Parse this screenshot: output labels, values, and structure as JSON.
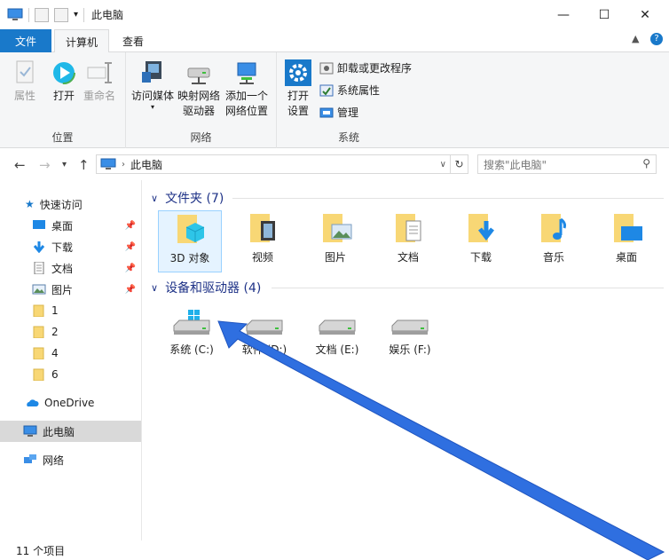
{
  "window": {
    "title": "此电脑",
    "minimize": "—",
    "maximize": "☐",
    "close": "✕"
  },
  "ribbon_tabs": {
    "file": "文件",
    "computer": "计算机",
    "view": "查看",
    "collapse": "▲",
    "help": "?"
  },
  "ribbon": {
    "location": {
      "label": "位置",
      "properties": "属性",
      "open": "打开",
      "rename": "重命名"
    },
    "network": {
      "label": "网络",
      "access_media": "访问媒体",
      "map_drive_1": "映射网络",
      "map_drive_2": "驱动器",
      "add_location_1": "添加一个",
      "add_location_2": "网络位置"
    },
    "system": {
      "label": "系统",
      "open_settings_1": "打开",
      "open_settings_2": "设置",
      "uninstall": "卸载或更改程序",
      "system_properties": "系统属性",
      "manage": "管理"
    }
  },
  "navigation": {
    "address": "此电脑",
    "search_placeholder": "搜索\"此电脑\""
  },
  "sidebar": {
    "items": [
      {
        "label": "快速访问"
      },
      {
        "label": "桌面"
      },
      {
        "label": "下载"
      },
      {
        "label": "文档"
      },
      {
        "label": "图片"
      },
      {
        "label": "1"
      },
      {
        "label": "2"
      },
      {
        "label": "4"
      },
      {
        "label": "6"
      },
      {
        "label": "OneDrive"
      },
      {
        "label": "此电脑"
      },
      {
        "label": "网络"
      }
    ]
  },
  "content": {
    "folders_header": "文件夹 (7)",
    "folders": [
      {
        "label": "3D 对象"
      },
      {
        "label": "视频"
      },
      {
        "label": "图片"
      },
      {
        "label": "文档"
      },
      {
        "label": "下载"
      },
      {
        "label": "音乐"
      },
      {
        "label": "桌面"
      }
    ],
    "drives_header": "设备和驱动器 (4)",
    "drives": [
      {
        "label": "系统 (C:)"
      },
      {
        "label": "软件 (D:)"
      },
      {
        "label": "文档 (E:)"
      },
      {
        "label": "娱乐 (F:)"
      }
    ]
  },
  "status": {
    "item_count": "11 个项目"
  },
  "colors": {
    "accent": "#1979ca",
    "folder_yellow": "#f8d775",
    "arrow_blue": "#2f6fe0"
  }
}
